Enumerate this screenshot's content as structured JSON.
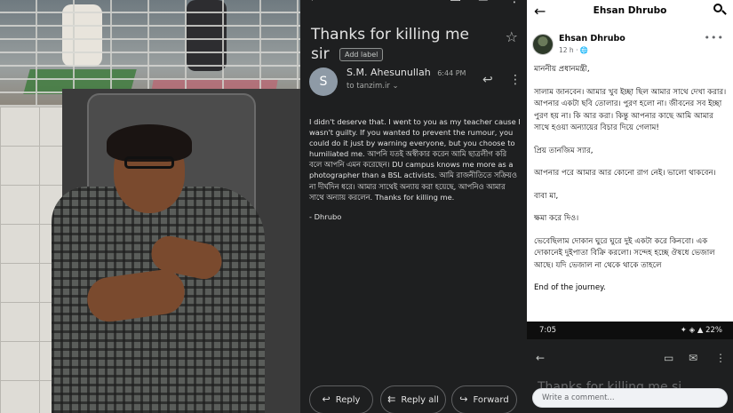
{
  "photo": {
    "alt_label": ""
  },
  "gmail": {
    "subject": "Thanks for killing me sir",
    "add_label": "Add label",
    "sender_name": "S.M. Ahesunullah",
    "sender_initial": "S",
    "time": "6:44 PM",
    "to_line": "to tanzim.ir",
    "body_paragraphs": [
      "I didn't deserve that. I went to you as my teacher cause I wasn't guilty. If you wanted to prevent the rumour, you could do it just by warning everyone, but you choose to humiliated me. আপনি যতই অস্বীকার করেন আমি ছাত্রলীগ করি বলে আপনি এমন করেছেন। DU campus knows me more as a photographer than a BSL activists. আমি রাজনীতিতে সক্রিয়ও না দীর্ঘদিন ধরে।  আমার সাথেই অন্যায় করা হয়েছে, আপনিও আমার সাথে অন্যায় করলেন. Thanks for killing me.",
      "- Dhrubo"
    ],
    "actions": {
      "reply": "Reply",
      "reply_all": "Reply all",
      "forward": "Forward"
    },
    "icons": {
      "back": "arrow-left-icon",
      "archive": "archive-icon",
      "mail": "mail-icon",
      "more": "more-vert-icon",
      "star": "star-icon",
      "reply": "reply-icon"
    }
  },
  "facebook": {
    "header_title": "Ehsan Dhrubo",
    "author": "Ehsan Dhrubo",
    "meta": "12 h · ",
    "post_paragraphs": [
      "মাননীয় প্রধানমন্ত্রী,",
      "সালাম জানবেন। আমার খুব ইচ্ছা ছিল আমার সাথে দেখা করার। আপনার একটা ছবি তোলার। পুরণ হলো না। জীবনের সব ইচ্ছা পুরণ হয় না। কি আর করা। কিন্তু আপনার কাছে আমি আমার সাথে হওয়া অন্যায়ের বিচার দিয়ে গেলাম!",
      "প্রিয় তানজিম স্যার,",
      "আপনার পরে আমার আর কোনো রাগ নেই। ভালো থাকবেন।",
      "বাবা মা,",
      "ক্ষমা করে দিও।",
      "ভেবেছিলাম দোকান ঘুরে ঘুরে দুই একটা করে কিনবো। এক দোকানেই দুইপাতা বিক্রি করলো।  সন্দেহ হচ্ছে ঔষধে ভেজাল আছে। যদি ভেজাল না থেকে থাকে তাহলে",
      "End of the journey."
    ],
    "status_time": "7:05",
    "status_battery": "22%",
    "ghost_subject": "Thanks for killing me si",
    "comment_placeholder": "Write a comment..."
  }
}
